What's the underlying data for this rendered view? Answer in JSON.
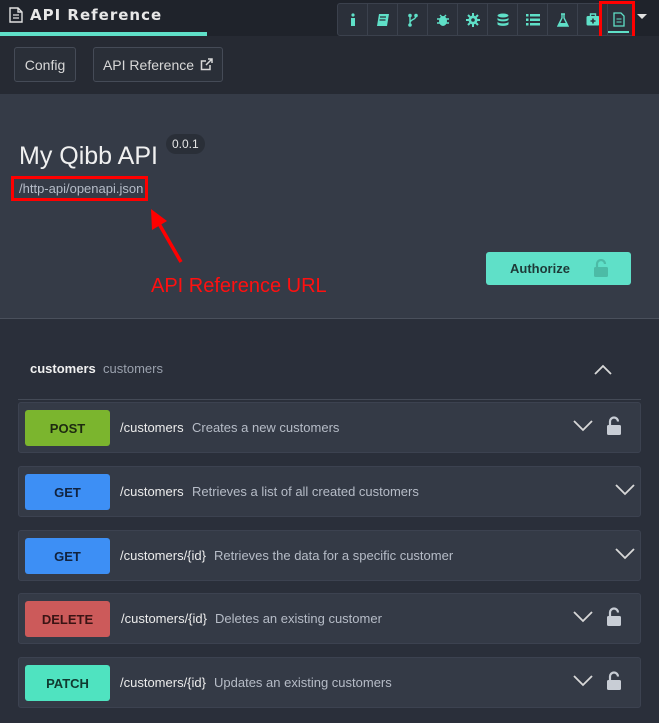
{
  "header": {
    "title": "API Reference",
    "toolbar_icons": [
      "info-icon",
      "book-icon",
      "branch-icon",
      "bug-icon",
      "gear-icon",
      "database-icon",
      "list-icon",
      "flask-icon",
      "medkit-icon",
      "document-icon"
    ],
    "selected_icon": "document-icon"
  },
  "subnav": {
    "config_label": "Config",
    "api_reference_label": "API Reference"
  },
  "info": {
    "title": "My Qibb API",
    "version": "0.0.1",
    "spec_url": "/http-api/openapi.json",
    "annotation": "API Reference URL",
    "authorize_label": "Authorize"
  },
  "tag": {
    "name": "customers",
    "description": "customers"
  },
  "operations": [
    {
      "method": "POST",
      "path": "/customers",
      "summary": "Creates a new customers",
      "locked": true,
      "color": "#7bb52e"
    },
    {
      "method": "GET",
      "path": "/customers",
      "summary": "Retrieves a list of all created customers",
      "locked": false,
      "color": "#3d8ff5"
    },
    {
      "method": "GET",
      "path": "/customers/{id}",
      "summary": "Retrieves the data for a specific customer",
      "locked": false,
      "color": "#3d8ff5"
    },
    {
      "method": "DELETE",
      "path": "/customers/{id}",
      "summary": "Deletes an existing customer",
      "locked": true,
      "color": "#cc5a5a"
    },
    {
      "method": "PATCH",
      "path": "/customers/{id}",
      "summary": "Updates an existing customers",
      "locked": true,
      "color": "#4fe3c0"
    }
  ],
  "colors": {
    "accent": "#5fe0c8",
    "annotation_red": "#ff0000"
  }
}
